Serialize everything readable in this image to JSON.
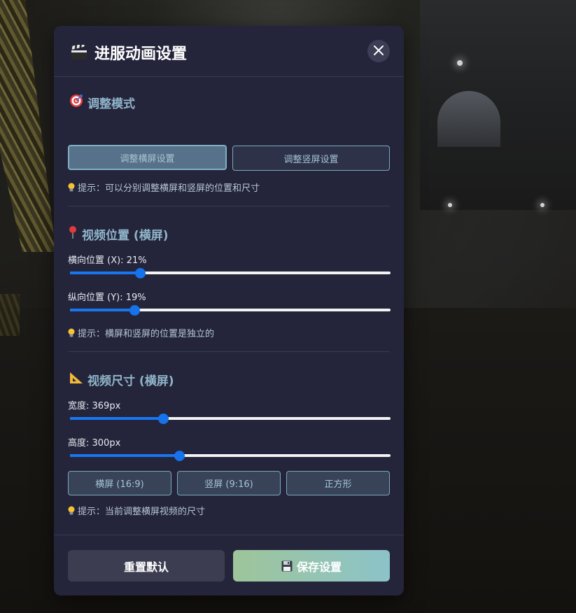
{
  "modal": {
    "title": "进服动画设置",
    "title_icon": "clapperboard-icon",
    "close_icon": "close-icon"
  },
  "mode_section": {
    "title": "调整模式",
    "icon": "target-icon",
    "buttons": [
      {
        "label": "调整横屏设置",
        "active": true
      },
      {
        "label": "调整竖屏设置",
        "active": false
      }
    ],
    "hint": "提示：可以分别调整横屏和竖屏的位置和尺寸"
  },
  "position_section": {
    "title": "视频位置 (横屏)",
    "icon": "pushpin-icon",
    "x_label": "横向位置 (X): 21%",
    "x_value": 21,
    "y_label": "纵向位置 (Y): 19%",
    "y_value": 19,
    "hint": "提示：横屏和竖屏的位置是独立的"
  },
  "size_section": {
    "title": "视频尺寸 (横屏)",
    "icon": "triangle-ruler-icon",
    "width_label": "宽度: 369px",
    "width_fraction": 0.29,
    "height_label": "高度: 300px",
    "height_fraction": 0.34,
    "presets": [
      {
        "label": "横屏 (16:9)"
      },
      {
        "label": "竖屏 (9:16)"
      },
      {
        "label": "正方形"
      }
    ],
    "hint": "提示：当前调整横屏视频的尺寸"
  },
  "footer": {
    "reset_label": "重置默认",
    "save_label": "保存设置",
    "save_icon": "floppy-disk-icon"
  },
  "colors": {
    "modal_bg": "#24253a",
    "accent": "#1976f2",
    "section_title": "#8fb4c9"
  }
}
